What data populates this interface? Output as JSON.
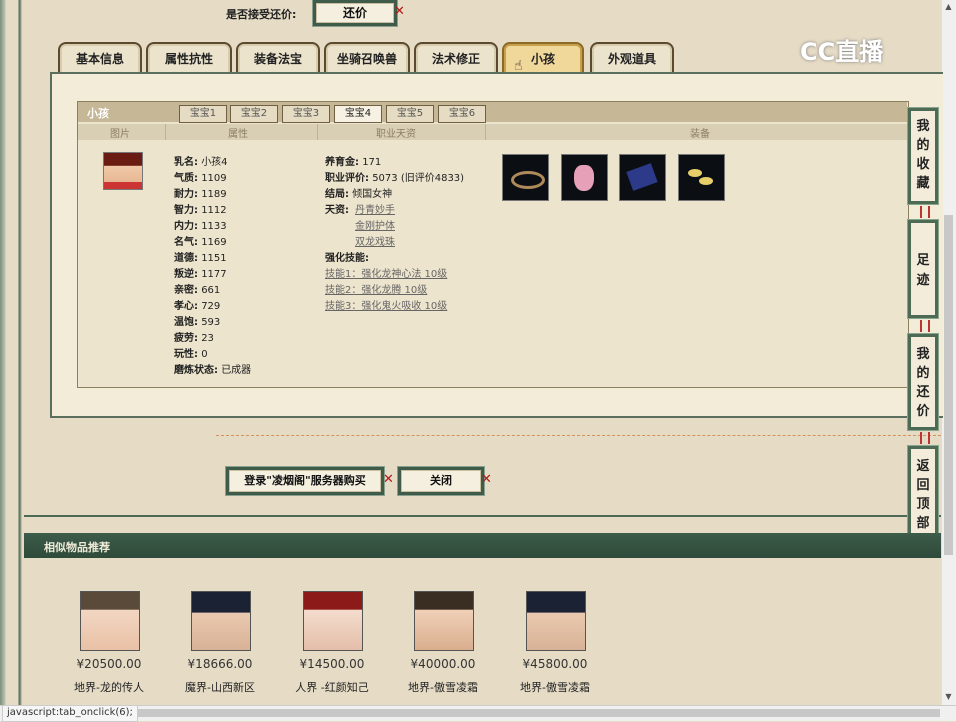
{
  "accept_bargain": {
    "label": "是否接受还价:",
    "button": "还价"
  },
  "logo_text": "CC直播",
  "tabs": [
    {
      "label": "基本信息"
    },
    {
      "label": "属性抗性"
    },
    {
      "label": "装备法宝"
    },
    {
      "label": "坐骑召唤兽"
    },
    {
      "label": "法术修正"
    },
    {
      "label": "小孩"
    },
    {
      "label": "外观道具"
    }
  ],
  "child_panel": {
    "title": "小孩",
    "subtabs": [
      "宝宝1",
      "宝宝2",
      "宝宝3",
      "宝宝4",
      "宝宝5",
      "宝宝6"
    ],
    "columns": [
      "图片",
      "属性",
      "职业天资",
      "装备"
    ],
    "attributes": [
      {
        "k": "乳名:",
        "v": "小孩4"
      },
      {
        "k": "气质:",
        "v": "1109"
      },
      {
        "k": "耐力:",
        "v": "1189"
      },
      {
        "k": "智力:",
        "v": "1112"
      },
      {
        "k": "内力:",
        "v": "1133"
      },
      {
        "k": "名气:",
        "v": "1169"
      },
      {
        "k": "道德:",
        "v": "1151"
      },
      {
        "k": "叛逆:",
        "v": "1177"
      },
      {
        "k": "亲密:",
        "v": "661"
      },
      {
        "k": "孝心:",
        "v": "729"
      },
      {
        "k": "温饱:",
        "v": "593"
      },
      {
        "k": "疲劳:",
        "v": "23"
      },
      {
        "k": "玩性:",
        "v": "0"
      },
      {
        "k": "磨炼状态:",
        "v": "已成器"
      }
    ],
    "career": {
      "nurture_label": "养育金:",
      "nurture": "171",
      "rating_label": "职业评价:",
      "rating": "5073 (旧评价4833)",
      "ending_label": "结局:",
      "ending": "倾国女神",
      "talent_label": "天资:",
      "talents": [
        "丹青妙手",
        "金刚护体",
        "双龙戏珠"
      ],
      "skills_label": "强化技能:",
      "skills": [
        "技能1：强化龙神心法 10级",
        "技能2：强化龙腾 10级",
        "技能3：强化鬼火吸收 10级"
      ]
    }
  },
  "buttons": {
    "login_buy": "登录\"凌烟阁\"服务器购买",
    "close": "关闭"
  },
  "side_nav": [
    "我的收藏",
    "足迹",
    "我的还价",
    "返回顶部"
  ],
  "similar": {
    "title": "相似物品推荐",
    "items": [
      {
        "price": "¥20500.00",
        "name": "地界-龙的传人"
      },
      {
        "price": "¥18666.00",
        "name": "魔界-山西新区"
      },
      {
        "price": "¥14500.00",
        "name": "人界 -红颜知己"
      },
      {
        "price": "¥40000.00",
        "name": "地界-傲雪凌霜"
      },
      {
        "price": "¥45800.00",
        "name": "地界-傲雪凌霜"
      }
    ]
  },
  "status_bar": "javascript:tab_onclick(6);"
}
